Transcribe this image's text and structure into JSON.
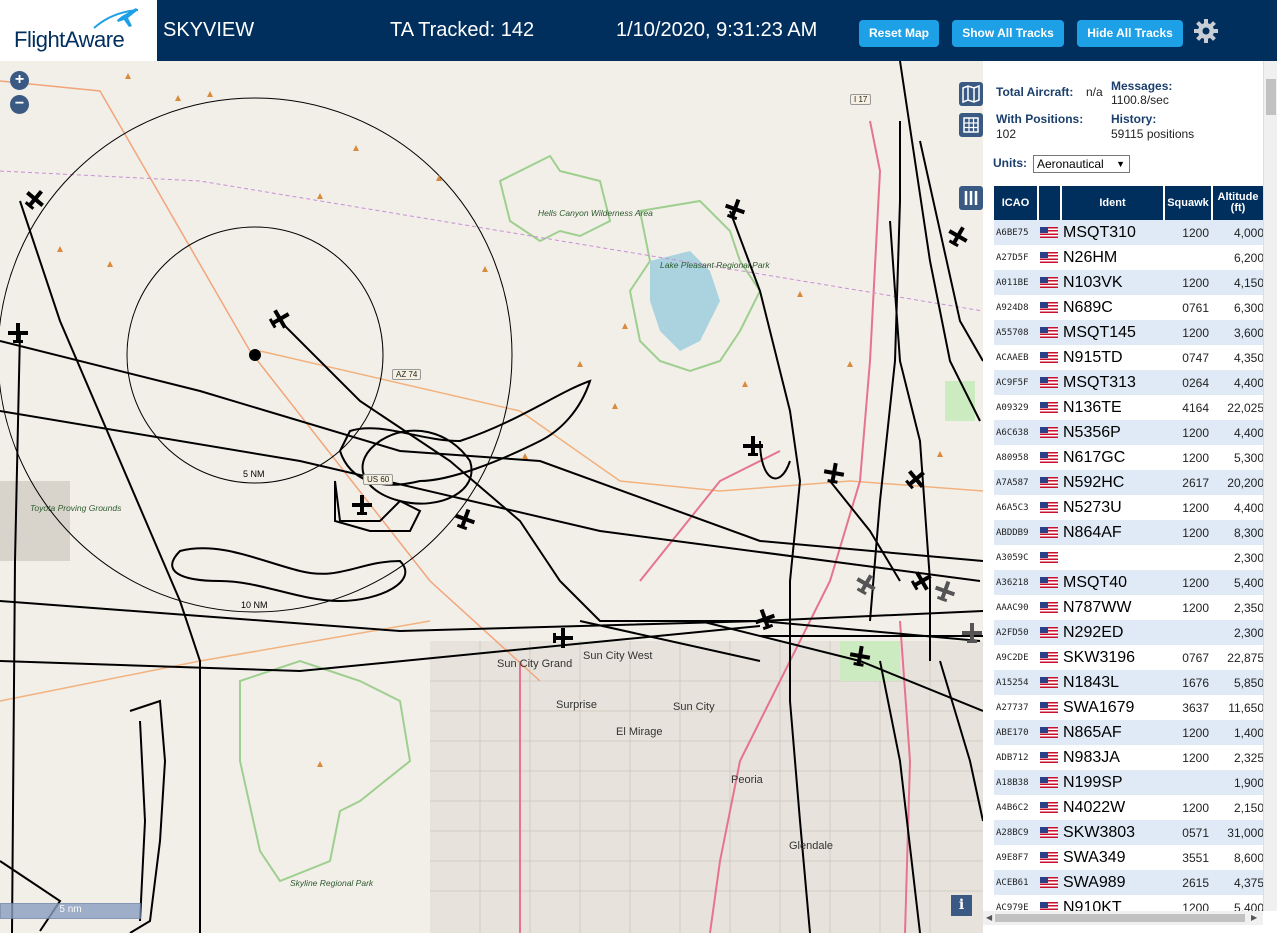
{
  "header": {
    "brand": "FlightAware",
    "app_name": "SKYVIEW",
    "tracked": "TA Tracked: 142",
    "datetime": "1/10/2020, 9:31:23 AM",
    "buttons": {
      "reset": "Reset Map",
      "show_all": "Show All Tracks",
      "hide_all": "Hide All Tracks"
    },
    "settings_icon": "gear-icon"
  },
  "map": {
    "zoom_in": "+",
    "zoom_out": "−",
    "labels": {
      "hells_canyon": "Hells Canyon Wilderness Area",
      "lake_pleasant": "Lake Pleasant Regional Park",
      "toyota": "Toyota Proving Grounds",
      "skyline": "Skyline Regional Park",
      "sun_city_grand": "Sun City Grand",
      "sun_city_west": "Sun City West",
      "surprise": "Surprise",
      "sun_city": "Sun City",
      "el_mirage": "El Mirage",
      "peoria": "Peoria",
      "glendale": "Glendale"
    },
    "ranges": {
      "r5": "5 NM",
      "r10": "10 NM"
    },
    "highways": {
      "az74": "AZ 74",
      "us60": "US 60",
      "i17": "I 17"
    },
    "scale": "5 nm",
    "info": "i"
  },
  "panel": {
    "total_aircraft_label": "Total Aircraft:",
    "total_aircraft_value": "n/a",
    "messages_label": "Messages:",
    "messages_value": "1100.8/sec",
    "with_positions_label": "With Positions:",
    "with_positions_value": "102",
    "history_label": "History:",
    "history_value": "59115 positions",
    "units_label": "Units:",
    "units_value": "Aeronautical",
    "columns": [
      "ICAO",
      "",
      "Ident",
      "Squawk",
      "Altitude (ft)"
    ],
    "rows": [
      {
        "icao": "A6BE75",
        "ident": "MSQT310",
        "squawk": "1200",
        "alt": "4,000"
      },
      {
        "icao": "A27D5F",
        "ident": "N26HM",
        "squawk": "",
        "alt": "6,200"
      },
      {
        "icao": "A011BE",
        "ident": "N103VK",
        "squawk": "1200",
        "alt": "4,150"
      },
      {
        "icao": "A924D8",
        "ident": "N689C",
        "squawk": "0761",
        "alt": "6,300"
      },
      {
        "icao": "A55708",
        "ident": "MSQT145",
        "squawk": "1200",
        "alt": "3,600"
      },
      {
        "icao": "ACAAEB",
        "ident": "N915TD",
        "squawk": "0747",
        "alt": "4,350"
      },
      {
        "icao": "AC9F5F",
        "ident": "MSQT313",
        "squawk": "0264",
        "alt": "4,400"
      },
      {
        "icao": "A09329",
        "ident": "N136TE",
        "squawk": "4164",
        "alt": "22,025"
      },
      {
        "icao": "A6C638",
        "ident": "N5356P",
        "squawk": "1200",
        "alt": "4,400"
      },
      {
        "icao": "A80958",
        "ident": "N617GC",
        "squawk": "1200",
        "alt": "5,300"
      },
      {
        "icao": "A7A587",
        "ident": "N592HC",
        "squawk": "2617",
        "alt": "20,200"
      },
      {
        "icao": "A6A5C3",
        "ident": "N5273U",
        "squawk": "1200",
        "alt": "4,400"
      },
      {
        "icao": "ABDDB9",
        "ident": "N864AF",
        "squawk": "1200",
        "alt": "8,300"
      },
      {
        "icao": "A3059C",
        "ident": "",
        "squawk": "",
        "alt": "2,300"
      },
      {
        "icao": "A36218",
        "ident": "MSQT40",
        "squawk": "1200",
        "alt": "5,400"
      },
      {
        "icao": "AAAC90",
        "ident": "N787WW",
        "squawk": "1200",
        "alt": "2,350"
      },
      {
        "icao": "A2FD50",
        "ident": "N292ED",
        "squawk": "",
        "alt": "2,300"
      },
      {
        "icao": "A9C2DE",
        "ident": "SKW3196",
        "squawk": "0767",
        "alt": "22,875"
      },
      {
        "icao": "A15254",
        "ident": "N1843L",
        "squawk": "1676",
        "alt": "5,850"
      },
      {
        "icao": "A27737",
        "ident": "SWA1679",
        "squawk": "3637",
        "alt": "11,650"
      },
      {
        "icao": "ABE170",
        "ident": "N865AF",
        "squawk": "1200",
        "alt": "1,400"
      },
      {
        "icao": "ADB712",
        "ident": "N983JA",
        "squawk": "1200",
        "alt": "2,325"
      },
      {
        "icao": "A18B38",
        "ident": "N199SP",
        "squawk": "",
        "alt": "1,900"
      },
      {
        "icao": "A4B6C2",
        "ident": "N4022W",
        "squawk": "1200",
        "alt": "2,150"
      },
      {
        "icao": "A28BC9",
        "ident": "SKW3803",
        "squawk": "0571",
        "alt": "31,000"
      },
      {
        "icao": "A9E8F7",
        "ident": "SWA349",
        "squawk": "3551",
        "alt": "8,600"
      },
      {
        "icao": "ACEB61",
        "ident": "SWA989",
        "squawk": "2615",
        "alt": "4,375"
      },
      {
        "icao": "AC979E",
        "ident": "N910KT",
        "squawk": "1200",
        "alt": "5,400"
      }
    ]
  }
}
